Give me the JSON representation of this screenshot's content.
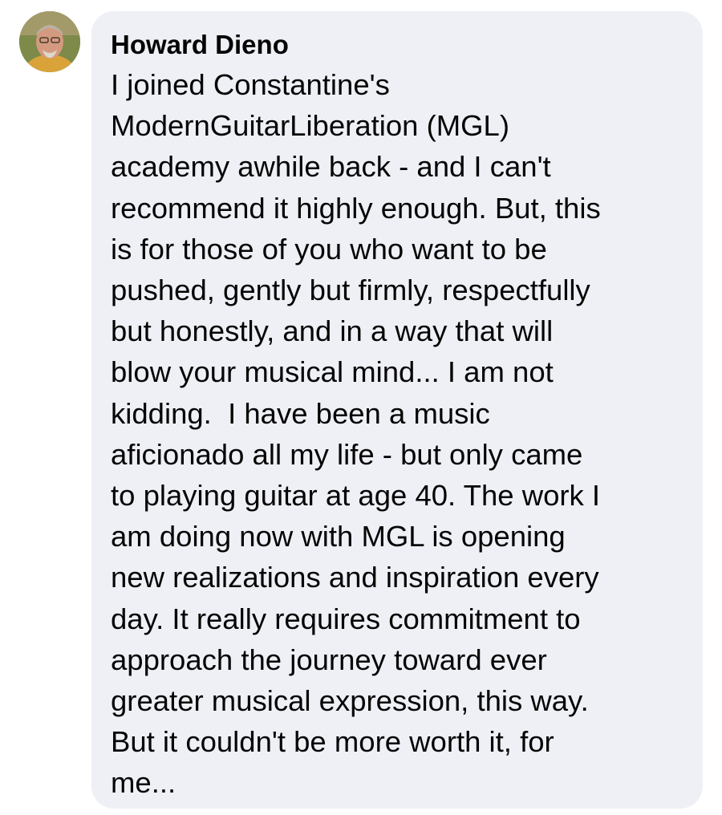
{
  "comment": {
    "author": "Howard Dieno",
    "avatar_icon": "user-avatar-photo",
    "lines": [
      "I joined Constantine's",
      "ModernGuitarLiberation (MGL)",
      "academy awhile back - and I can't",
      "recommend it highly enough. But, this",
      "is for those of you who want to be",
      "pushed, gently but firmly, respectfully",
      "but honestly, and in a way that will",
      "blow your musical mind... I am not",
      "kidding.  I have been a music",
      "aficionado all my life - but only came",
      "to playing guitar at age 40. The work I",
      "am doing now with MGL is opening",
      "new realizations and inspiration every",
      "day. It really requires commitment to",
      "approach the journey toward ever",
      "greater musical expression, this way.",
      "But it couldn't be more worth it, for",
      "me..."
    ]
  },
  "colors": {
    "bubble_bg": "#eff0f5",
    "text": "#050505"
  }
}
